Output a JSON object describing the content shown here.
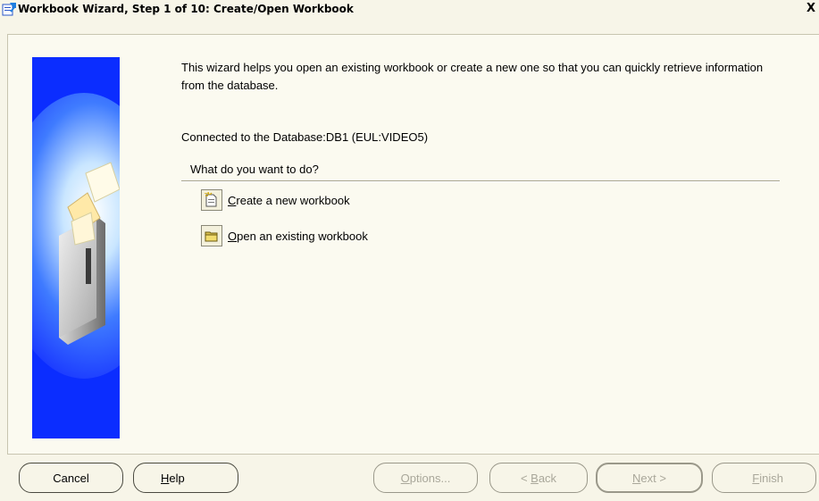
{
  "window": {
    "title": "Workbook Wizard, Step 1 of 10: Create/Open Workbook",
    "close_label": "X"
  },
  "content": {
    "intro": "This wizard helps you open an existing workbook or create a new one so that you can quickly retrieve information from the database.",
    "connection": "Connected to the Database:DB1 (EUL:VIDEO5)",
    "question": "What do you want to do?",
    "actions": {
      "create": {
        "mnemonic": "C",
        "label_rest": "reate a new workbook"
      },
      "open": {
        "mnemonic": "O",
        "label_rest": "pen an existing workbook"
      }
    }
  },
  "buttons": {
    "cancel": "Cancel",
    "help": {
      "mnemonic": "H",
      "rest": "elp"
    },
    "options": {
      "mnemonic": "O",
      "rest": "ptions..."
    },
    "back": {
      "arrow": "<",
      "mnemonic": "B",
      "rest": "ack"
    },
    "next": {
      "mnemonic": "N",
      "rest": "ext",
      "arrow": ">"
    },
    "finish": {
      "mnemonic": "F",
      "rest": "inish"
    }
  },
  "colors": {
    "side_panel_blue": "#0b2dff",
    "background": "#f7f5e8",
    "divider": "#a9a690",
    "disabled_text": "#a9a79a"
  },
  "icons": {
    "title": "wizard-app-icon",
    "close": "close-icon",
    "create": "new-workbook-icon",
    "open": "open-folder-icon",
    "side": "filing-cabinet-illustration"
  }
}
